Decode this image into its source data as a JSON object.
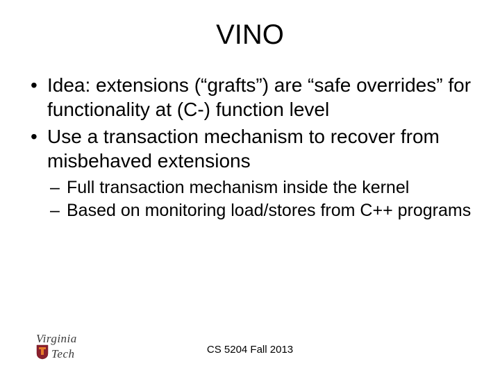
{
  "title": "VINO",
  "bullets": [
    "Idea: extensions (“grafts”) are “safe overrides” for functionality at (C-) function level",
    "Use a transaction mechanism to recover from misbehaved extensions"
  ],
  "sub_bullets": [
    "Full transaction mechanism inside the kernel",
    "Based on monitoring load/stores from C++ programs"
  ],
  "footer": "CS 5204 Fall 2013",
  "logo": {
    "line1": "Virginia",
    "line2": "Tech"
  },
  "colors": {
    "maroon": "#8a1f2d",
    "orange": "#e47b2a"
  }
}
